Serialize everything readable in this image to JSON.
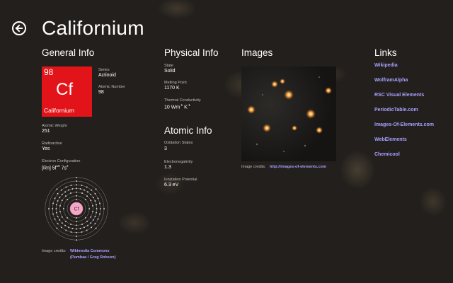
{
  "header": {
    "title": "Californium",
    "back_icon": "back-arrow-icon"
  },
  "general": {
    "heading": "General Info",
    "tile": {
      "number": "98",
      "symbol": "Cf",
      "name": "Californium",
      "color": "#e2141a"
    },
    "series_label": "Series",
    "series_value": "Actinoid",
    "atomic_number_label": "Atomic Number",
    "atomic_number_value": "98",
    "atomic_weight_label": "Atomic Weight",
    "atomic_weight_value": "251",
    "radioactive_label": "Radioactive",
    "radioactive_value": "Yes",
    "electron_config_label": "Electron Configuration",
    "shell_diagram_symbol": "Cf",
    "credits_label": "Image credits:",
    "credits_link_line1": "Wikimedia Commons",
    "credits_link_line2": "(Pumbaa / Greg Robson)"
  },
  "physical": {
    "heading": "Physical Info",
    "state_label": "State",
    "state_value": "Solid",
    "melting_label": "Melting Point",
    "melting_value": "1170 K",
    "thermal_label": "Thermal Conductivity"
  },
  "atomic": {
    "heading": "Atomic Info",
    "oxidation_label": "Oxidation States",
    "oxidation_value": "3",
    "electroneg_label": "Electronegativity",
    "electroneg_value": "1.3",
    "ionization_label": "Ionization Potential",
    "ionization_value": "6.3 eV"
  },
  "images": {
    "heading": "Images",
    "credits_label": "Image credits:",
    "credits_link": "http://images-of-elements.com"
  },
  "links": {
    "heading": "Links",
    "items": [
      "Wikipedia",
      "WolframAlpha",
      "RSC Visual Elements",
      "PeriodicTable.com",
      "Images-Of-Elements.com",
      "WebElements",
      "Chemicool"
    ]
  },
  "colors": {
    "accent_link": "#a9a1ff",
    "tile_red": "#e2141a",
    "nucleus_pink": "#f4a6c8"
  }
}
